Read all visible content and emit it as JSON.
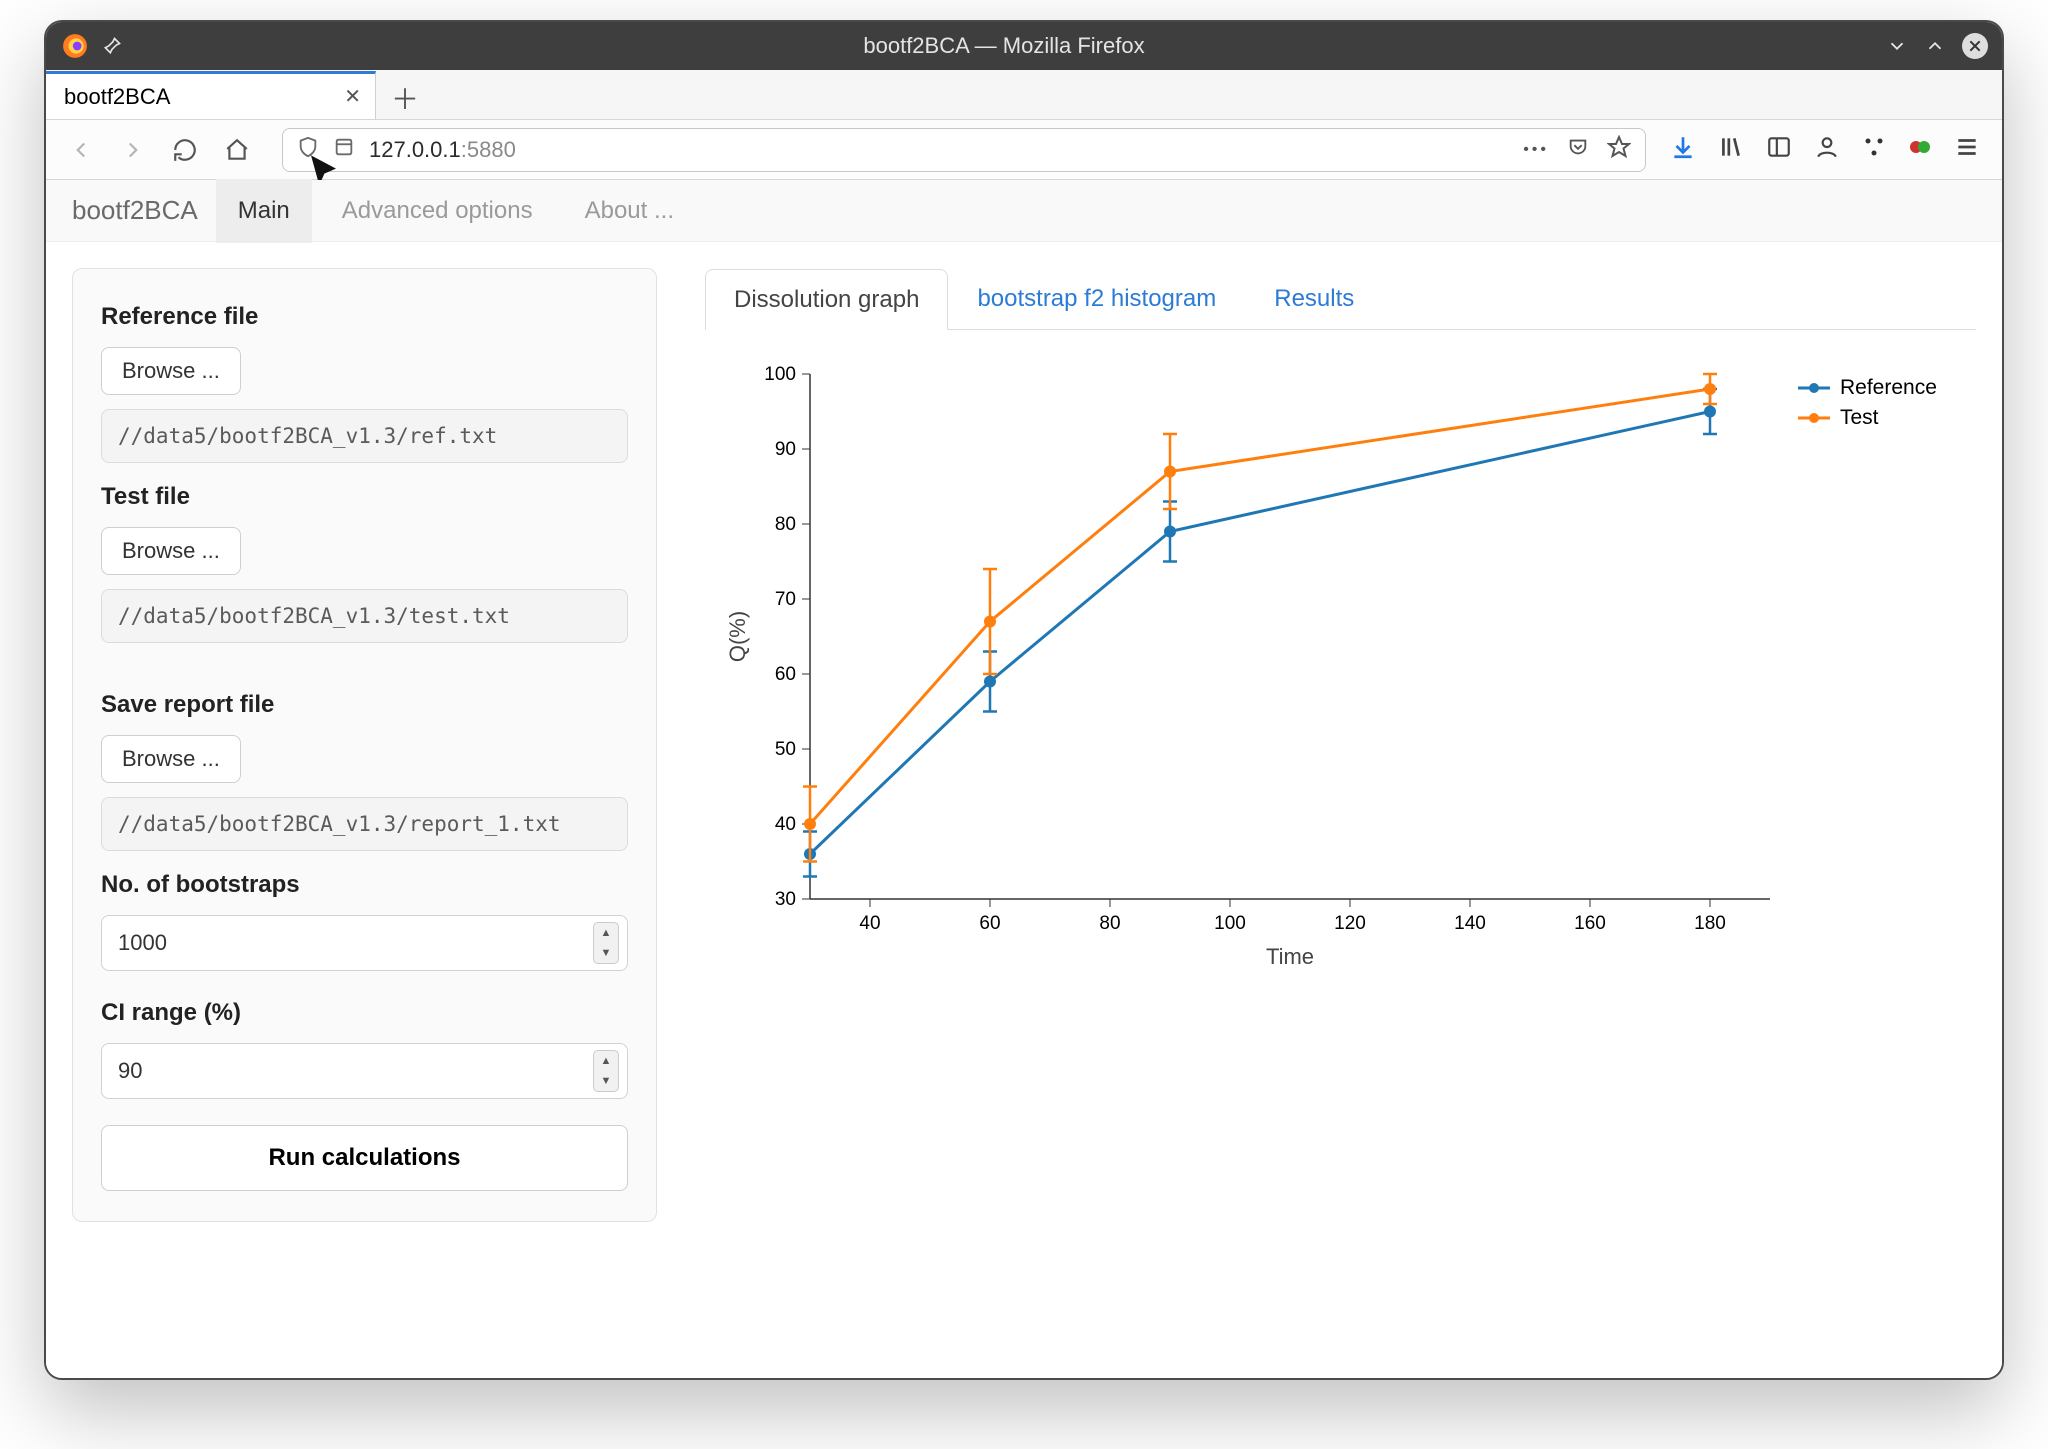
{
  "window": {
    "title": "bootf2BCA — Mozilla Firefox",
    "tab_title": "bootf2BCA",
    "url_host": "127.0.0.1",
    "url_port": ":5880"
  },
  "app": {
    "brand": "bootf2BCA",
    "nav": {
      "main": "Main",
      "advanced": "Advanced options",
      "about": "About ..."
    },
    "sidebar": {
      "ref_label": "Reference file",
      "test_label": "Test file",
      "save_label": "Save report file",
      "nboot_label": "No. of bootstraps",
      "ci_label": "CI range (%)",
      "browse_btn": "Browse ...",
      "ref_path": "//data5/bootf2BCA_v1.3/ref.txt",
      "test_path": "//data5/bootf2BCA_v1.3/test.txt",
      "save_path": "//data5/bootf2BCA_v1.3/report_1.txt",
      "nboot_value": "1000",
      "ci_value": "90",
      "run_btn": "Run calculations"
    },
    "chart_tabs": {
      "dissolution": "Dissolution graph",
      "hist": "bootstrap f2 histogram",
      "results": "Results"
    },
    "legend": {
      "ref": "Reference",
      "test": "Test"
    },
    "xlabel": "Time",
    "ylabel": "Q(%)"
  },
  "chart_data": {
    "type": "line",
    "xlabel": "Time",
    "ylabel": "Q(%)",
    "xlim": [
      30,
      190
    ],
    "ylim": [
      30,
      100
    ],
    "xticks": [
      40,
      60,
      80,
      100,
      120,
      140,
      160,
      180
    ],
    "yticks": [
      30,
      40,
      50,
      60,
      70,
      80,
      90,
      100
    ],
    "x": [
      30,
      60,
      90,
      180
    ],
    "series": [
      {
        "name": "Reference",
        "color": "#1f77b4",
        "values": [
          36,
          59,
          79,
          95
        ],
        "err": [
          3,
          4,
          4,
          3
        ]
      },
      {
        "name": "Test",
        "color": "#ff7f0e",
        "values": [
          40,
          67,
          87,
          98
        ],
        "err": [
          5,
          7,
          5,
          2
        ]
      }
    ]
  }
}
